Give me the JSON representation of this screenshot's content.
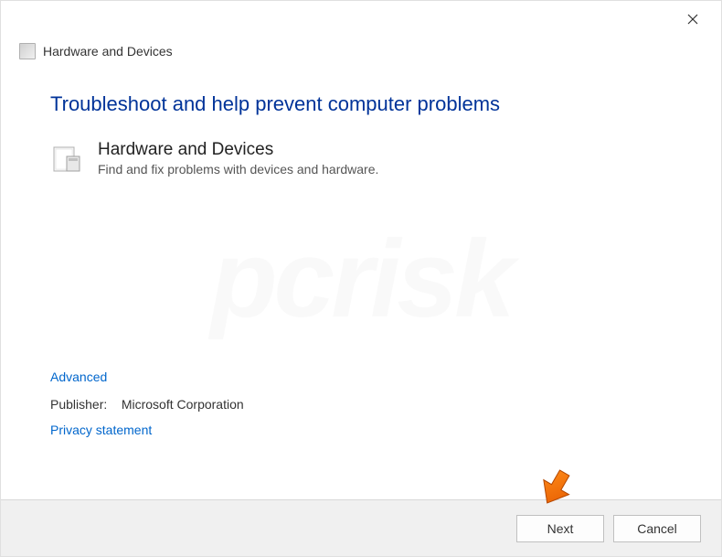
{
  "titlebar": {
    "window_title": "Hardware and Devices"
  },
  "content": {
    "main_heading": "Troubleshoot and help prevent computer problems",
    "troubleshooter": {
      "title": "Hardware and Devices",
      "description": "Find and fix problems with devices and hardware."
    }
  },
  "lower": {
    "advanced_link": "Advanced",
    "publisher_label": "Publisher:",
    "publisher_value": "Microsoft Corporation",
    "privacy_link": "Privacy statement"
  },
  "footer": {
    "next_label": "Next",
    "cancel_label": "Cancel"
  }
}
